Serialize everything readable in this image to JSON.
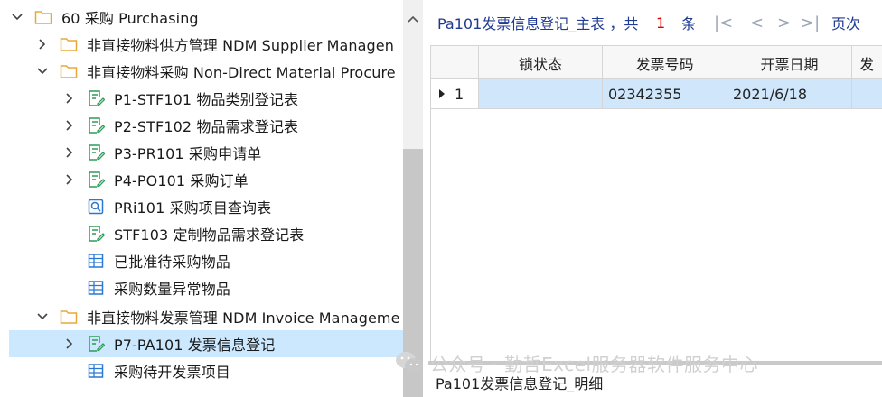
{
  "tree": {
    "items": [
      {
        "label": "60 采购 Purchasing",
        "icon": "folder-icon",
        "expanded": true
      },
      {
        "label": "非直接物料供方管理 NDM Supplier Managen",
        "icon": "folder-icon",
        "expanded": false
      },
      {
        "label": "非直接物料采购 Non-Direct Material Procure",
        "icon": "folder-icon",
        "expanded": true
      },
      {
        "label": "P1-STF101 物品类别登记表",
        "icon": "form-icon",
        "expanded": false
      },
      {
        "label": "P2-STF102 物品需求登记表",
        "icon": "form-icon",
        "expanded": false
      },
      {
        "label": "P3-PR101 采购申请单",
        "icon": "form-icon",
        "expanded": false
      },
      {
        "label": "P4-PO101 采购订单",
        "icon": "form-icon",
        "expanded": false
      },
      {
        "label": "PRi101 采购项目查询表",
        "icon": "query-icon"
      },
      {
        "label": "STF103 定制物品需求登记表",
        "icon": "form-icon"
      },
      {
        "label": "已批准待采购物品",
        "icon": "table-icon"
      },
      {
        "label": "采购数量异常物品",
        "icon": "table-icon"
      },
      {
        "label": "非直接物料发票管理 NDM Invoice Manageme",
        "icon": "folder-icon",
        "expanded": true
      },
      {
        "label": "P7-PA101 发票信息登记",
        "icon": "form-icon",
        "expanded": false,
        "selected": true
      },
      {
        "label": "采购待开发票项目",
        "icon": "table-icon"
      }
    ]
  },
  "nav": {
    "title": "Pa101发票信息登记_主表 ，共",
    "count": "1",
    "unit": "条",
    "first": "|<",
    "prev": "<",
    "next": ">",
    "last": ">|",
    "page_button": "页次"
  },
  "grid": {
    "columns": [
      "锁状态",
      "发票号码",
      "开票日期",
      "发"
    ],
    "rows": [
      {
        "index": "1",
        "cells": [
          "",
          "02342355",
          "2021/6/18",
          ""
        ]
      }
    ]
  },
  "detail_title": "Pa101发票信息登记_明细",
  "watermark": "公众号 · 勤哲Excel服务器软件服务中心",
  "colors": {
    "folder": "#e8a838",
    "form": "#2e9b58",
    "table": "#2a78d2",
    "selected_row": "#cce8ff",
    "grid_selected": "#cfe6fb",
    "title_blue": "#1f3a93",
    "count_red": "#e60000"
  }
}
